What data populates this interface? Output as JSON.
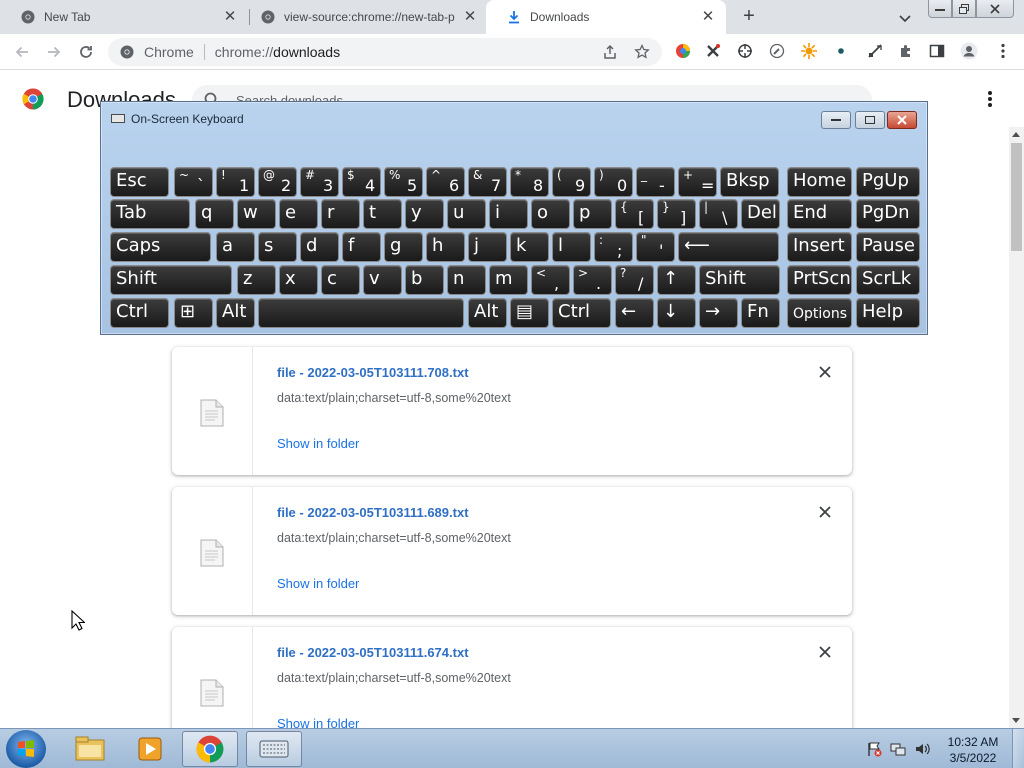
{
  "tabs": [
    {
      "title": "New Tab",
      "icon": "chrome-icon",
      "active": false
    },
    {
      "title": "view-source:chrome://new-tab-p",
      "icon": "chrome-icon",
      "active": false
    },
    {
      "title": "Downloads",
      "icon": "download-icon",
      "active": true
    }
  ],
  "toolbar": {
    "site_label": "Chrome",
    "url_scheme": "chrome://",
    "url_path": "downloads"
  },
  "page": {
    "title": "Downloads",
    "search_placeholder": "Search downloads"
  },
  "downloads": [
    {
      "filename": "file - 2022-03-05T103111.708.txt",
      "url": "data:text/plain;charset=utf-8,some%20text",
      "action": "Show in folder"
    },
    {
      "filename": "file - 2022-03-05T103111.689.txt",
      "url": "data:text/plain;charset=utf-8,some%20text",
      "action": "Show in folder"
    },
    {
      "filename": "file - 2022-03-05T103111.674.txt",
      "url": "data:text/plain;charset=utf-8,some%20text",
      "action": "Show in folder"
    }
  ],
  "osk": {
    "title": "On-Screen Keyboard",
    "rows": [
      [
        {
          "m": "Esc"
        },
        {
          "s": "~",
          "b": "`"
        },
        {
          "s": "!",
          "b": "1"
        },
        {
          "s": "@",
          "b": "2"
        },
        {
          "s": "#",
          "b": "3"
        },
        {
          "s": "$",
          "b": "4"
        },
        {
          "s": "%",
          "b": "5"
        },
        {
          "s": "^",
          "b": "6"
        },
        {
          "s": "&",
          "b": "7"
        },
        {
          "s": "*",
          "b": "8"
        },
        {
          "s": "(",
          "b": "9"
        },
        {
          "s": ")",
          "b": "0"
        },
        {
          "s": "_",
          "b": "-"
        },
        {
          "s": "+",
          "b": "="
        },
        {
          "m": "Bksp"
        },
        {
          "m": "Home"
        },
        {
          "m": "PgUp"
        }
      ],
      [
        {
          "m": "Tab"
        },
        {
          "m": "q"
        },
        {
          "m": "w"
        },
        {
          "m": "e"
        },
        {
          "m": "r"
        },
        {
          "m": "t"
        },
        {
          "m": "y"
        },
        {
          "m": "u"
        },
        {
          "m": "i"
        },
        {
          "m": "o"
        },
        {
          "m": "p"
        },
        {
          "s": "{",
          "b": "["
        },
        {
          "s": "}",
          "b": "]"
        },
        {
          "s": "|",
          "b": "\\"
        },
        {
          "m": "Del"
        },
        {
          "m": "End"
        },
        {
          "m": "PgDn"
        }
      ],
      [
        {
          "m": "Caps"
        },
        {
          "m": "a"
        },
        {
          "m": "s"
        },
        {
          "m": "d"
        },
        {
          "m": "f"
        },
        {
          "m": "g"
        },
        {
          "m": "h"
        },
        {
          "m": "j"
        },
        {
          "m": "k"
        },
        {
          "m": "l"
        },
        {
          "s": ":",
          "b": ";"
        },
        {
          "s": "\"",
          "b": "'"
        },
        {
          "m": "⟵"
        },
        {
          "m": "Insert"
        },
        {
          "m": "Pause"
        }
      ],
      [
        {
          "m": "Shift"
        },
        {
          "m": "z"
        },
        {
          "m": "x"
        },
        {
          "m": "c"
        },
        {
          "m": "v"
        },
        {
          "m": "b"
        },
        {
          "m": "n"
        },
        {
          "m": "m"
        },
        {
          "s": "<",
          "b": ","
        },
        {
          "s": ">",
          "b": "."
        },
        {
          "s": "?",
          "b": "/"
        },
        {
          "m": "↑"
        },
        {
          "m": "Shift"
        },
        {
          "m": "PrtScn"
        },
        {
          "m": "ScrLk"
        }
      ],
      [
        {
          "m": "Ctrl"
        },
        {
          "m": "⊞"
        },
        {
          "m": "Alt"
        },
        {
          "m": ""
        },
        {
          "m": "Alt"
        },
        {
          "m": "▤"
        },
        {
          "m": "Ctrl"
        },
        {
          "m": "←"
        },
        {
          "m": "↓"
        },
        {
          "m": "→"
        },
        {
          "m": "Fn"
        },
        {
          "m": "Options"
        },
        {
          "m": "Help"
        }
      ]
    ]
  },
  "taskbar": {
    "time": "10:32 AM",
    "date": "3/5/2022",
    "apps": [
      "explorer-icon",
      "media-player-icon",
      "chrome-icon",
      "on-screen-keyboard-icon"
    ]
  },
  "colors": {
    "link": "#1a73e8",
    "tabstrip": "#dee1e6",
    "osk_frame": "#b9d3ef",
    "key": "#1f1f1f"
  }
}
